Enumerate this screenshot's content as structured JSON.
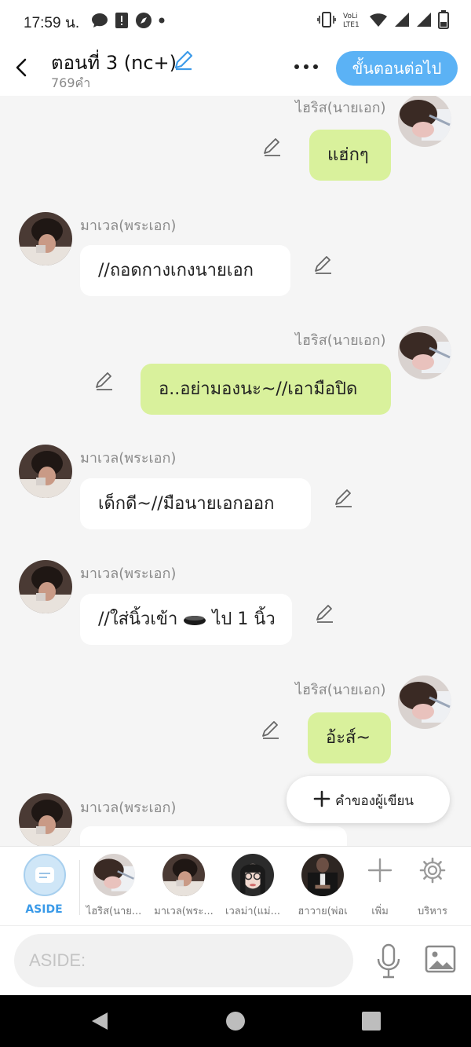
{
  "status_bar": {
    "time": "17:59 น.",
    "icons_left": [
      "chat-bubble-icon",
      "alert-icon",
      "compass-icon",
      "dot-icon"
    ],
    "icons_right": [
      "vibrate-icon",
      "volte-icon",
      "wifi-icon",
      "signal-icon",
      "signal-icon",
      "battery-icon"
    ],
    "volte_text": "VoLTE1"
  },
  "header": {
    "title": "ตอนที่ 3 (nc+)",
    "word_count": "769คำ",
    "next_label": "ขั้นตอนต่อไป",
    "accent": "#5bb2f5"
  },
  "messages": [
    {
      "side": "right",
      "speaker": "ไฮริส(นายเอก)",
      "text": "แฮ่กๆ"
    },
    {
      "side": "left",
      "speaker": "มาเวล(พระเอก)",
      "text": "//ถอดกางเกงนายเอก"
    },
    {
      "side": "right",
      "speaker": "ไฮริส(นายเอก)",
      "text": "อ..อย่ามองนะ~//เอามือปิด"
    },
    {
      "side": "left",
      "speaker": "มาเวล(พระเอก)",
      "text": "เด็กดี~//มือนายเอกออก"
    },
    {
      "side": "left",
      "speaker": "มาเวล(พระเอก)",
      "text": "//ใส่นิ้วเข้า",
      "text_after": "ไป 1 นิ้ว"
    },
    {
      "side": "right",
      "speaker": "ไฮริส(นายเอก)",
      "text": "อ้ะส์~"
    },
    {
      "side": "left",
      "speaker": "มาเวล(พระเอก)",
      "text": ""
    }
  ],
  "fab": {
    "label": "คำของผู้เขียน"
  },
  "characters": {
    "aside_label": "ASIDE",
    "items": [
      {
        "name": "ไฮริส(นาย..."
      },
      {
        "name": "มาเวล(พระ..."
      },
      {
        "name": "เวลม่า(แม่..."
      },
      {
        "name": "ฮาวาย(พ่อเ"
      }
    ],
    "add_label": "เพิ่ม",
    "manage_label": "บริหาร"
  },
  "input": {
    "placeholder": "ASIDE:"
  },
  "colors": {
    "bubble_right": "#d9f19c",
    "bubble_left": "#ffffff",
    "background": "#f5f5f5"
  }
}
